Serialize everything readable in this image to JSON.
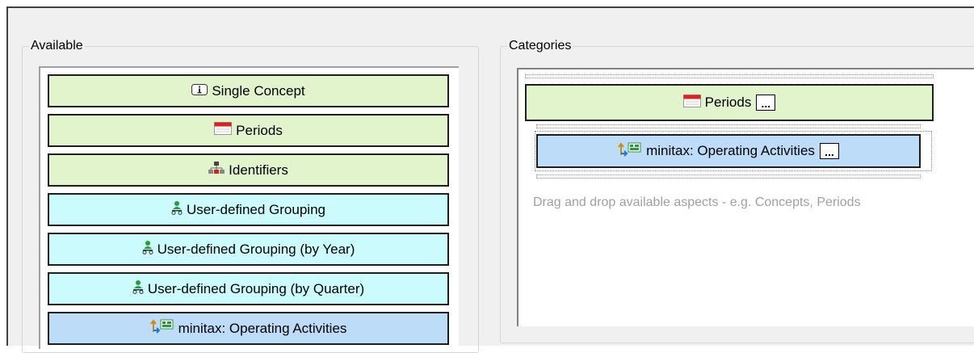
{
  "available": {
    "label": "Available",
    "items": [
      {
        "label": "Single Concept",
        "icon": "info-icon",
        "color": "#e2f4cc"
      },
      {
        "label": "Periods",
        "icon": "calendar-icon",
        "color": "#e2f4cc"
      },
      {
        "label": "Identifiers",
        "icon": "hierarchy-icon",
        "color": "#e2f4cc"
      },
      {
        "label": "User-defined Grouping",
        "icon": "user-group-icon",
        "color": "#ccfbfd"
      },
      {
        "label": "User-defined Grouping (by Year)",
        "icon": "user-group-icon",
        "color": "#ccfbfd"
      },
      {
        "label": "User-defined Grouping (by Quarter)",
        "icon": "user-group-icon",
        "color": "#ccfbfd"
      },
      {
        "label": "minitax: Operating Activities",
        "icon": "concept-tree-icon",
        "color": "#bcdcf8"
      }
    ]
  },
  "categories": {
    "label": "Categories",
    "items": [
      {
        "label": "Periods",
        "icon": "calendar-icon",
        "button": "..."
      },
      {
        "label": "minitax: Operating Activities",
        "icon": "concept-tree-icon",
        "button": "..."
      }
    ],
    "hint": "Drag and drop available aspects - e.g. Concepts, Periods"
  }
}
